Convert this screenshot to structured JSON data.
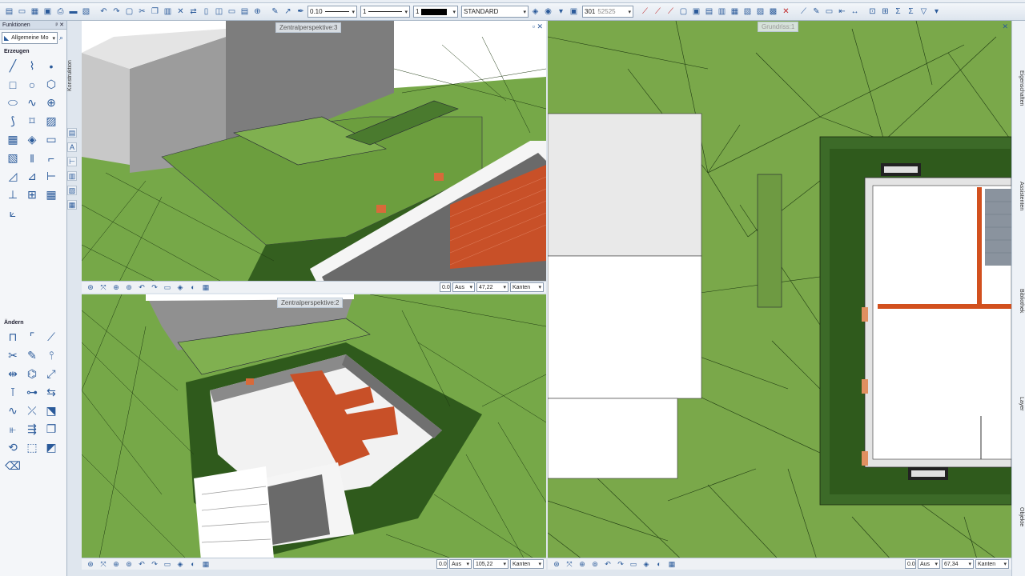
{
  "toolbar": {
    "pen_value": "0.10",
    "line_value": "1",
    "color_value": "1",
    "layer_value": "STANDARD",
    "surface_value": "301",
    "surface_name": "52525"
  },
  "palette": {
    "title": "Funktionen",
    "module": "Allgemeine Mo",
    "section_create": "Erzeugen",
    "section_modify": "Ändern",
    "side_tab": "Konstruktion"
  },
  "viewports": {
    "top_left": {
      "title": "Zentralperspektive:3",
      "angle": "0.0",
      "mode": "Aus",
      "zoom": "47,22",
      "render": "Kanten"
    },
    "bottom_left": {
      "title": "Zentralperspektive:2",
      "angle": "0.0",
      "mode": "Aus",
      "zoom": "105,22",
      "render": "Kanten"
    },
    "right": {
      "title": "Grundriss:1",
      "angle": "0.0",
      "mode": "Aus",
      "zoom": "67,34",
      "render": "Kanten"
    }
  },
  "right_tabs": {
    "properties": "Eigenschaften",
    "assistants": "Assistenten",
    "library": "Bibliothek",
    "layer": "Layer",
    "objects": "Objekte"
  },
  "icons": {
    "create": [
      "line-icon",
      "polyline-icon",
      "point-icon",
      "rectangle-icon",
      "circle-icon",
      "polygon-icon",
      "ellipse-icon",
      "spline-icon",
      "cross-circle-icon",
      "shape-icon",
      "freeform-icon",
      "hatch-icon",
      "pattern-icon",
      "fill-icon",
      "image-icon",
      "filling-icon",
      "parallel-icon",
      "offset-icon",
      "dimension-icon",
      "dimension-angle-icon",
      "text-icon",
      "axis-icon",
      "grid-icon",
      "table-icon",
      "measure-icon"
    ],
    "modify": [
      "trim-icon",
      "fillet-icon",
      "chamfer-icon",
      "cut-icon",
      "edit-icon",
      "split-icon",
      "stretch-icon",
      "modify-icon",
      "extend-icon",
      "join-icon",
      "offset-modify-icon",
      "mirror-icon",
      "wave-icon",
      "cross-icon",
      "array-icon",
      "align-icon",
      "move-icon",
      "copy-icon",
      "rotate-icon",
      "scale-icon",
      "color-icon",
      "erase-icon"
    ]
  }
}
